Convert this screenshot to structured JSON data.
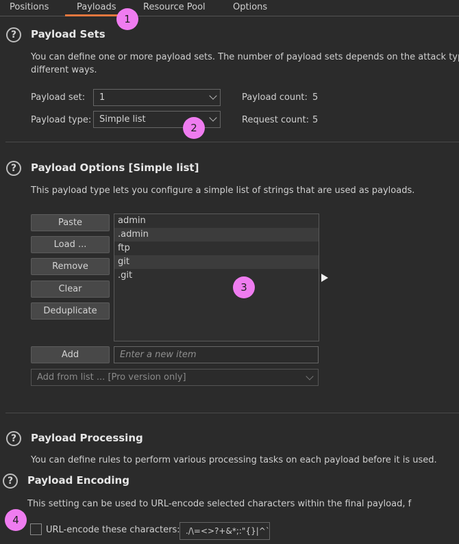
{
  "tabs": [
    "Positions",
    "Payloads",
    "Resource Pool",
    "Options"
  ],
  "payload_sets": {
    "title": "Payload Sets",
    "desc_line1": "You can define one or more payload sets. The number of payload sets depends on the attack type",
    "desc_line2": "different ways.",
    "set_label": "Payload set:",
    "set_value": "1",
    "type_label": "Payload type:",
    "type_value": "Simple list",
    "payload_count_label": "Payload count:",
    "payload_count": "5",
    "request_count_label": "Request count:",
    "request_count": "5"
  },
  "payload_options": {
    "title": "Payload Options [Simple list]",
    "desc": "This payload type lets you configure a simple list of strings that are used as payloads.",
    "buttons": {
      "paste": "Paste",
      "load": "Load ...",
      "remove": "Remove",
      "clear": "Clear",
      "deduplicate": "Deduplicate",
      "add": "Add"
    },
    "items": [
      "admin",
      ".admin",
      "ftp",
      "git",
      ".git"
    ],
    "add_placeholder": "Enter a new item",
    "add_from_list": "Add from list ... [Pro version only]"
  },
  "payload_processing": {
    "title": "Payload Processing",
    "desc": "You can define rules to perform various processing tasks on each payload before it is used."
  },
  "payload_encoding": {
    "title": "Payload Encoding",
    "desc": "This setting can be used to URL-encode selected characters within the final payload, f",
    "checkbox_label": "URL-encode these characters:",
    "characters": "./\\=<>?+&*;:\"{}|^`"
  },
  "markers": [
    "1",
    "2",
    "3",
    "4"
  ],
  "colors": {
    "accent": "#e8773e",
    "marker": "#ef7cf0",
    "background": "#2b2b2b"
  }
}
